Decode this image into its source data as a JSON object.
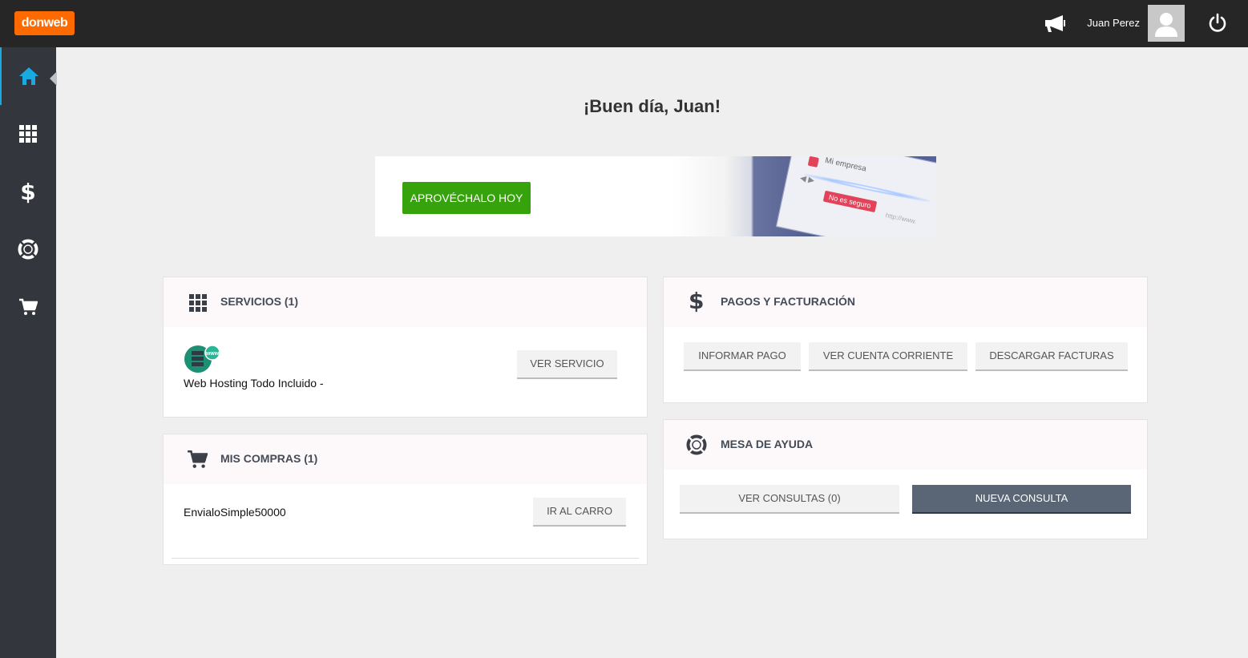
{
  "header": {
    "logo_text": "donweb",
    "user_name": "Juan Perez",
    "icons": {
      "announcements": "megaphone-icon",
      "avatar": "user-avatar-icon",
      "logout": "power-icon"
    },
    "brand_color": "#ff6a00"
  },
  "sidebar": {
    "items": [
      {
        "icon": "home-icon",
        "active": true
      },
      {
        "icon": "grid-icon",
        "active": false
      },
      {
        "icon": "dollar-icon",
        "active": false
      },
      {
        "icon": "lifebuoy-icon",
        "active": false
      },
      {
        "icon": "cart-icon",
        "active": false
      }
    ],
    "active_color": "#19a8e0"
  },
  "greeting": "¡Buen día, Juan!",
  "banner": {
    "cta_label": "APROVÉCHALO HOY",
    "browser_tab": "Mi empresa",
    "warning_text": "No es seguro",
    "cta_color": "#36a30c"
  },
  "servicios": {
    "title": "SERVICIOS (1)",
    "items": [
      {
        "name": "Web Hosting Todo Incluido -",
        "badge": "www"
      }
    ],
    "button": "VER SERVICIO"
  },
  "compras": {
    "title": "MIS COMPRAS (1)",
    "items": [
      {
        "name": "EnvialoSimple50000"
      }
    ],
    "button": "IR AL CARRO"
  },
  "pagos": {
    "title": "PAGOS Y FACTURACIÓN",
    "buttons": [
      "INFORMAR PAGO",
      "VER CUENTA CORRIENTE",
      "DESCARGAR FACTURAS"
    ]
  },
  "ayuda": {
    "title": "MESA DE AYUDA",
    "buttons": [
      "VER CONSULTAS (0)",
      "NUEVA CONSULTA"
    ]
  }
}
